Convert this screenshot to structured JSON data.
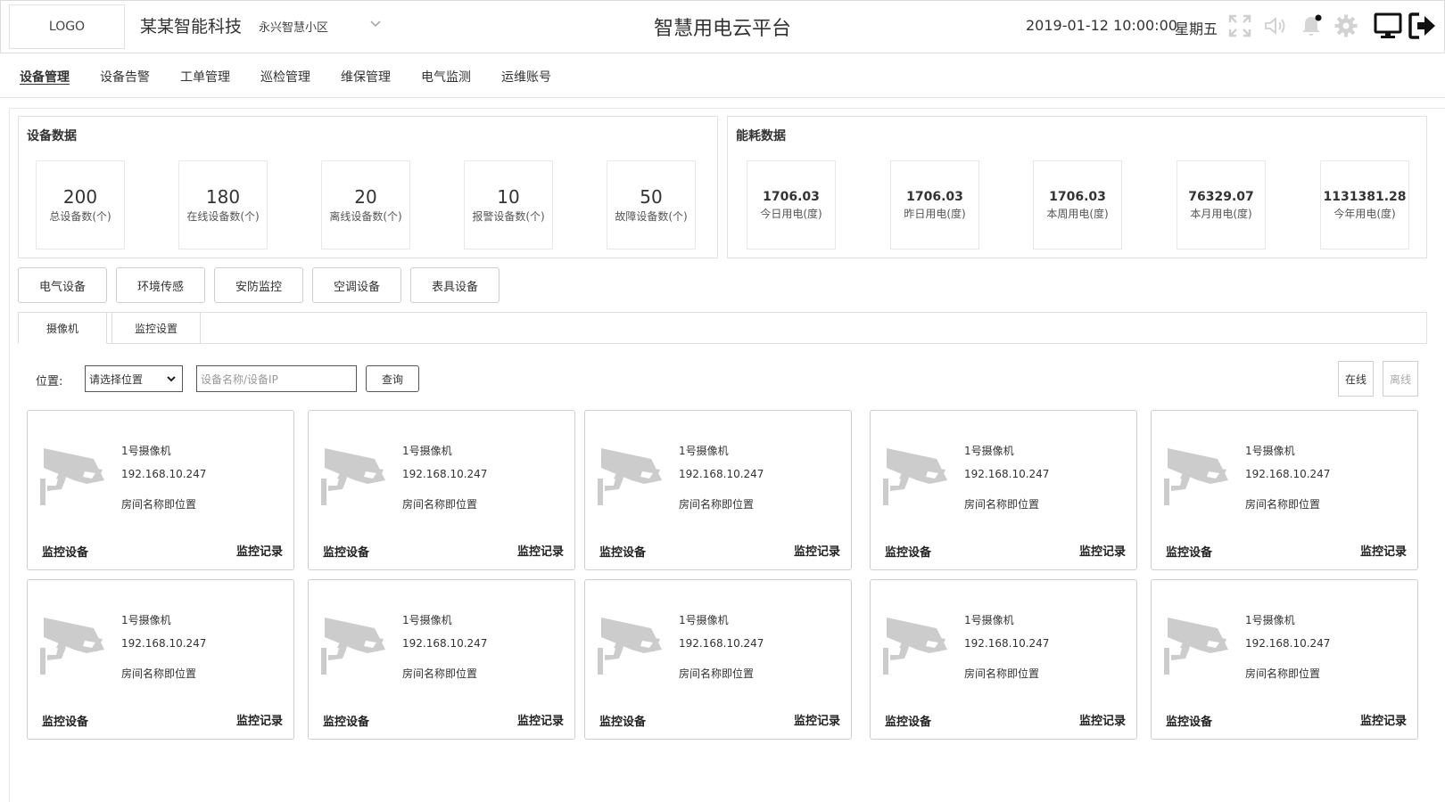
{
  "header": {
    "logo": "LOGO",
    "company": "某某智能科技",
    "community": "永兴智慧小区",
    "title": "智慧用电云平台",
    "datetime": "2019-01-12 10:00:00",
    "weekday": "星期五",
    "icons": [
      "fullscreen-icon",
      "volume-icon",
      "bell-icon",
      "gear-icon",
      "monitor-icon",
      "logout-icon"
    ]
  },
  "nav": [
    "设备管理",
    "设备告警",
    "工单管理",
    "巡检管理",
    "维保管理",
    "电气监测",
    "运维账号"
  ],
  "device_data": {
    "title": "设备数据",
    "stats": [
      {
        "value": "200",
        "label": "总设备数(个)"
      },
      {
        "value": "180",
        "label": "在线设备数(个)"
      },
      {
        "value": "20",
        "label": "离线设备数(个)"
      },
      {
        "value": "10",
        "label": "报警设备数(个)"
      },
      {
        "value": "50",
        "label": "故障设备数(个)"
      }
    ]
  },
  "energy_data": {
    "title": "能耗数据",
    "stats": [
      {
        "value": "1706.03",
        "label": "今日用电(度)"
      },
      {
        "value": "1706.03",
        "label": "昨日用电(度)"
      },
      {
        "value": "1706.03",
        "label": "本周用电(度)"
      },
      {
        "value": "76329.07",
        "label": "本月用电(度)"
      },
      {
        "value": "1131381.28",
        "label": "今年用电(度)"
      }
    ]
  },
  "categories": [
    "电气设备",
    "环境传感",
    "安防监控",
    "空调设备",
    "表具设备"
  ],
  "subtabs": [
    "摄像机",
    "监控设置"
  ],
  "filter": {
    "location_label": "位置:",
    "location_select": "请选择位置",
    "search_placeholder": "设备名称/设备IP",
    "query_button": "查询",
    "online": "在线",
    "offline": "离线"
  },
  "cameras": [
    {
      "name": "1号摄像机",
      "ip": "192.168.10.247",
      "location": "房间名称即位置",
      "monitor": "监控设备",
      "record": "监控记录"
    },
    {
      "name": "1号摄像机",
      "ip": "192.168.10.247",
      "location": "房间名称即位置",
      "monitor": "监控设备",
      "record": "监控记录"
    },
    {
      "name": "1号摄像机",
      "ip": "192.168.10.247",
      "location": "房间名称即位置",
      "monitor": "监控设备",
      "record": "监控记录"
    },
    {
      "name": "1号摄像机",
      "ip": "192.168.10.247",
      "location": "房间名称即位置",
      "monitor": "监控设备",
      "record": "监控记录"
    },
    {
      "name": "1号摄像机",
      "ip": "192.168.10.247",
      "location": "房间名称即位置",
      "monitor": "监控设备",
      "record": "监控记录"
    },
    {
      "name": "1号摄像机",
      "ip": "192.168.10.247",
      "location": "房间名称即位置",
      "monitor": "监控设备",
      "record": "监控记录"
    },
    {
      "name": "1号摄像机",
      "ip": "192.168.10.247",
      "location": "房间名称即位置",
      "monitor": "监控设备",
      "record": "监控记录"
    },
    {
      "name": "1号摄像机",
      "ip": "192.168.10.247",
      "location": "房间名称即位置",
      "monitor": "监控设备",
      "record": "监控记录"
    },
    {
      "name": "1号摄像机",
      "ip": "192.168.10.247",
      "location": "房间名称即位置",
      "monitor": "监控设备",
      "record": "监控记录"
    },
    {
      "name": "1号摄像机",
      "ip": "192.168.10.247",
      "location": "房间名称即位置",
      "monitor": "监控设备",
      "record": "监控记录"
    }
  ]
}
